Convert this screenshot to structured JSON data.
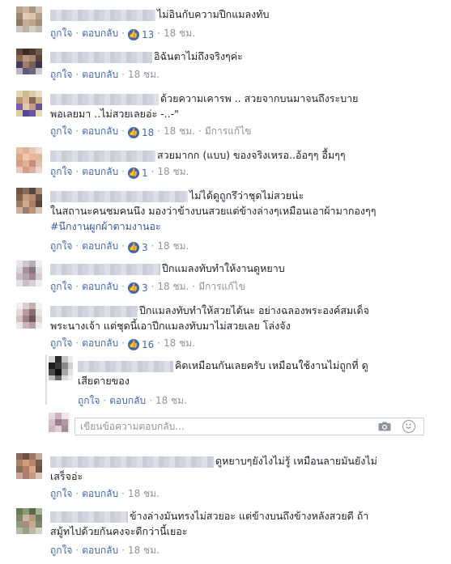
{
  "actions": {
    "like": "ถูกใจ",
    "reply": "ตอบกลับ",
    "edited": "มีการแก้ไข"
  },
  "reply_box": {
    "placeholder": "เขียนข้อความตอบกลับ..."
  },
  "comments": [
    {
      "text": "ไม่อินกับความปีกแมลงทับ",
      "likes": "13",
      "time": "18 ชม."
    },
    {
      "text": "อิฉันตาไม่ถึงจริงๆค่ะ",
      "time": "18 ชม."
    },
    {
      "line1": "ด้วยความเคารพ .. สวยจากบนมาจนถึงระบาย",
      "line2": "พอเลยมา ..ไม่สวยเลยอ่ะ -..-\"",
      "likes": "18",
      "time": "18 ชม."
    },
    {
      "text": "สวยมากก (แบบ) ของจริงเหรอ..อ้อๆๆ อื้มๆๆ",
      "likes": "1",
      "time": "18 ชม."
    },
    {
      "line1": "ไม่ได้ดูถูกรึว่าชุดไม่สวยน่ะ",
      "line2": "ในสถานะคนชมคนนึง มองว่าข้างบนสวยแต่ข้างล่างๆเหมือนเอาผ้ามากองๆๆ",
      "hashtag": "#นึกงานผูกผ้าตามงานอะ",
      "likes": "3",
      "time": "18 ชม."
    },
    {
      "text": "ปีกแมลงทับทำให้งานดูหยาบ",
      "likes": "3",
      "time": "18 ชม."
    },
    {
      "line1": "ปีกแมลงทับทำให้สวยได้นะ อย่างฉลองพระองค์สมเด็จ",
      "line2": "พระนางเจ้า แต่ชุดนี้เอาปีกแมลงทับมาไม่สวยเลย โล่งจัง",
      "likes": "16",
      "time": "18 ชม."
    },
    {
      "line1": "คิดเหมือนกันเลยครับ เหมือนใช้งานไม่ถูกที่ ดู",
      "line2": "เสียดายของ",
      "time": "18 ชม."
    },
    {
      "line1": "ดูหยาบๆยังไงไม่รู้ เหมือนลายมันยังไม่",
      "line2": "เสร็จอ่ะ",
      "time": "18 ชม."
    },
    {
      "line1": "ข้างล่างมันทรงไม่สวยอะ แต่ข้างบนถึงข้างหลังสวยดี ถ้า",
      "line2": "สมู้ทไปด้วยกันคงจะดีกว่านี้เยอะ",
      "time": "18 ชม."
    }
  ]
}
